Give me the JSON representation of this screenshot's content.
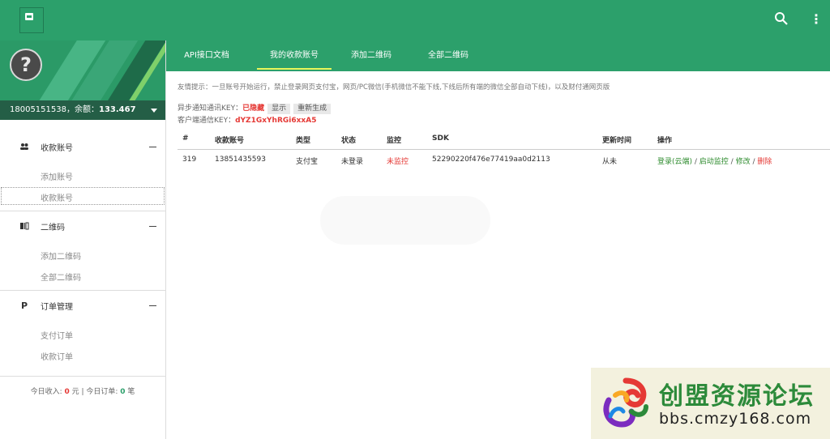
{
  "topbar": {
    "logo_icon": "chat-logo-icon",
    "search_icon": "search-icon",
    "more_icon": "more-vertical-icon"
  },
  "sidebar": {
    "avatar_glyph": "?",
    "account": {
      "phone": "18005151538",
      "balance_label": "，余额：",
      "balance": "133.467"
    },
    "groups": [
      {
        "label": "收款账号",
        "icon": "people-icon",
        "items": [
          {
            "label": "添加账号"
          },
          {
            "label": "收款账号"
          }
        ]
      },
      {
        "label": "二维码",
        "icon": "qrcode-icon",
        "items": [
          {
            "label": "添加二维码"
          },
          {
            "label": "全部二维码"
          }
        ]
      },
      {
        "label": "订单管理",
        "icon": "paypal-icon",
        "items": [
          {
            "label": "支付订单"
          },
          {
            "label": "收款订单"
          }
        ]
      }
    ],
    "today": {
      "income_label": "今日收入: ",
      "income": "0",
      "income_unit": " 元 ",
      "divider": "|",
      "orders_label": " 今日订单: ",
      "orders": "0",
      "orders_unit": " 笔"
    }
  },
  "tabs": [
    {
      "label": "API接口文档"
    },
    {
      "label": "我的收款账号",
      "active": true
    },
    {
      "label": "添加二维码"
    },
    {
      "label": "全部二维码"
    }
  ],
  "notice": "友情提示：一旦账号开始运行，禁止登录网页支付宝，网页/PC微信(手机微信不能下线,下线后所有端的微信全部自动下线)，以及财付通网页版",
  "keys": {
    "async_label": "异步通知通讯KEY：",
    "async_value": "已隐藏",
    "show_button": "显示",
    "regen_button": "重新生成",
    "client_label": "客户端通信KEY：",
    "client_value": "dYZ1GxYhRGi6xxA5"
  },
  "table": {
    "headers": [
      "#",
      "收款账号",
      "类型",
      "状态",
      "监控",
      "SDK",
      "更新时间",
      "操作"
    ],
    "rows": [
      {
        "id": "319",
        "account": "13851435593",
        "type": "支付宝",
        "status": "未登录",
        "monitor": "未监控",
        "sdk": "52290220f476e77419aa0d2113",
        "updated": "从未",
        "ops": {
          "login": "登录(云端)",
          "start": "启动监控",
          "edit": "修改",
          "delete": "删除",
          "sep": " / "
        }
      }
    ]
  },
  "watermark": {
    "title": "创盟资源论坛",
    "url": "bbs.cmzy168.com"
  }
}
